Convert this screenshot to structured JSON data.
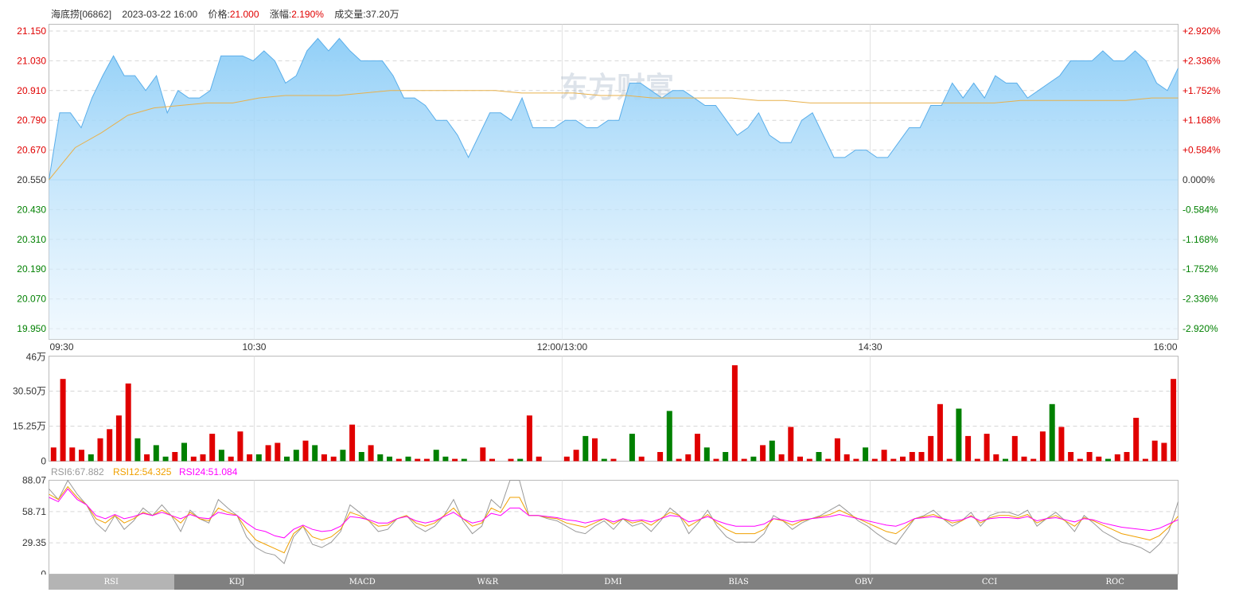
{
  "header": {
    "name_code": "海底捞[06862]",
    "datetime": "2023-03-22 16:00",
    "price_label": "价格:",
    "price_value": "21.000",
    "change_label": "涨幅:",
    "change_value": "2.190%",
    "volume_label": "成交量:",
    "volume_value": "37.20万"
  },
  "watermark": "东方财富",
  "colors": {
    "up": "#e00000",
    "down": "#008000",
    "price_line": "#5aaeea",
    "avg_line": "#e8b14c",
    "rsi6": "#999999",
    "rsi12": "#f0a000",
    "rsi24": "#ff00ff"
  },
  "tabs": [
    {
      "label": "RSI",
      "active": true
    },
    {
      "label": "KDJ",
      "active": false
    },
    {
      "label": "MACD",
      "active": false
    },
    {
      "label": "W&R",
      "active": false
    },
    {
      "label": "DMI",
      "active": false
    },
    {
      "label": "BIAS",
      "active": false
    },
    {
      "label": "OBV",
      "active": false
    },
    {
      "label": "CCI",
      "active": false
    },
    {
      "label": "ROC",
      "active": false
    }
  ],
  "rsi_legend": [
    {
      "label": "RSI6:67.882",
      "color": "#999999"
    },
    {
      "label": "RSI12:54.325",
      "color": "#f0a000"
    },
    {
      "label": "RSI24:51.084",
      "color": "#ff00ff"
    }
  ],
  "chart_data": [
    {
      "type": "area",
      "name": "intraday-price",
      "y_left_ticks": [
        "21.150",
        "21.030",
        "20.910",
        "20.790",
        "20.670",
        "20.550",
        "20.430",
        "20.310",
        "20.190",
        "20.070",
        "19.950"
      ],
      "y_right_ticks": [
        "+2.920%",
        "+2.336%",
        "+1.752%",
        "+1.168%",
        "+0.584%",
        "0.000%",
        "-0.584%",
        "-1.168%",
        "-1.752%",
        "-2.336%",
        "-2.920%"
      ],
      "x_ticks": [
        "09:30",
        "10:30",
        "12:00/13:00",
        "14:30",
        "16:00"
      ],
      "ylim": [
        19.95,
        21.15
      ],
      "base_price": 20.55,
      "price_series": [
        20.55,
        20.82,
        20.82,
        20.76,
        20.88,
        20.97,
        21.05,
        20.97,
        20.97,
        20.91,
        20.97,
        20.82,
        20.91,
        20.88,
        20.88,
        20.91,
        21.05,
        21.05,
        21.05,
        21.03,
        21.07,
        21.03,
        20.94,
        20.97,
        21.07,
        21.12,
        21.07,
        21.12,
        21.07,
        21.03,
        21.03,
        21.03,
        20.97,
        20.88,
        20.88,
        20.85,
        20.79,
        20.79,
        20.73,
        20.64,
        20.73,
        20.82,
        20.82,
        20.79,
        20.88,
        20.76,
        20.76,
        20.76,
        20.79,
        20.79,
        20.76,
        20.76,
        20.79,
        20.79,
        20.94,
        20.94,
        20.91,
        20.88,
        20.91,
        20.91,
        20.88,
        20.85,
        20.85,
        20.79,
        20.73,
        20.76,
        20.82,
        20.73,
        20.7,
        20.7,
        20.79,
        20.82,
        20.73,
        20.64,
        20.64,
        20.67,
        20.67,
        20.64,
        20.64,
        20.7,
        20.76,
        20.76,
        20.85,
        20.85,
        20.94,
        20.88,
        20.94,
        20.88,
        20.97,
        20.94,
        20.94,
        20.88,
        20.91,
        20.94,
        20.97,
        21.03,
        21.03,
        21.03,
        21.07,
        21.03,
        21.03,
        21.07,
        21.03,
        20.94,
        20.91,
        21.0
      ],
      "avg_series": [
        20.55,
        20.68,
        20.74,
        20.81,
        20.84,
        20.85,
        20.86,
        20.86,
        20.88,
        20.89,
        20.89,
        20.89,
        20.9,
        20.91,
        20.91,
        20.91,
        20.91,
        20.91,
        20.9,
        20.9,
        20.9,
        20.89,
        20.89,
        20.88,
        20.88,
        20.88,
        20.88,
        20.87,
        20.87,
        20.86,
        20.86,
        20.86,
        20.86,
        20.86,
        20.86,
        20.86,
        20.86,
        20.87,
        20.87,
        20.87,
        20.87,
        20.87,
        20.88,
        20.88
      ]
    },
    {
      "type": "bar",
      "name": "volume",
      "y_ticks": [
        "46万",
        "30.50万",
        "15.25万",
        "0"
      ],
      "ylim": [
        0,
        46
      ],
      "unit": "万",
      "values": [
        6,
        36,
        6,
        5,
        3,
        10,
        14,
        20,
        34,
        10,
        3,
        7,
        2,
        4,
        8,
        2,
        3,
        12,
        5,
        2,
        13,
        3,
        3,
        7,
        8,
        2,
        5,
        9,
        7,
        3,
        2,
        5,
        16,
        4,
        7,
        3,
        2,
        1,
        2,
        1,
        1,
        5,
        2,
        1,
        1,
        0,
        6,
        1,
        0,
        1,
        1,
        20,
        2,
        0,
        0,
        2,
        5,
        11,
        10,
        1,
        1,
        0,
        12,
        2,
        0,
        4,
        22,
        1,
        3,
        12,
        6,
        1,
        4,
        42,
        1,
        2,
        7,
        9,
        3,
        15,
        2,
        1,
        4,
        1,
        10,
        3,
        1,
        6,
        1,
        5,
        1,
        2,
        4,
        4,
        11,
        25,
        1,
        23,
        11,
        1,
        12,
        3,
        1,
        11,
        2,
        1,
        13,
        25,
        15,
        4,
        1,
        4,
        2,
        1,
        3,
        4,
        19,
        1,
        9,
        8,
        36
      ],
      "up": [
        1,
        1,
        1,
        1,
        0,
        1,
        1,
        1,
        1,
        0,
        1,
        0,
        0,
        1,
        0,
        1,
        1,
        1,
        0,
        1,
        1,
        1,
        0,
        1,
        1,
        0,
        0,
        1,
        0,
        1,
        1,
        0,
        1,
        0,
        1,
        0,
        0,
        1,
        0,
        1,
        1,
        0,
        0,
        1,
        0,
        1,
        1,
        1,
        0,
        1,
        0,
        1,
        1,
        1,
        1,
        1,
        1,
        0,
        1,
        0,
        1,
        1,
        0,
        1,
        0,
        1,
        0,
        1,
        1,
        1,
        0,
        1,
        0,
        1,
        1,
        0,
        1,
        0,
        1,
        1,
        1,
        1,
        0,
        1,
        1,
        1,
        1,
        0,
        1,
        1,
        1,
        1,
        1,
        1,
        1,
        1,
        1,
        0,
        1,
        1,
        1,
        1,
        0,
        1,
        1,
        1,
        1,
        0,
        1,
        1,
        1,
        1,
        1,
        0,
        1,
        1,
        1,
        1,
        1,
        1,
        1
      ]
    },
    {
      "type": "line",
      "name": "rsi",
      "y_ticks": [
        "88.07",
        "58.71",
        "29.35",
        "0"
      ],
      "ylim": [
        0,
        88.07
      ],
      "series": [
        {
          "name": "RSI6",
          "color": "#999999",
          "values": [
            80,
            70,
            88,
            75,
            65,
            48,
            40,
            55,
            42,
            50,
            62,
            55,
            65,
            55,
            40,
            60,
            52,
            48,
            70,
            62,
            55,
            35,
            25,
            20,
            18,
            10,
            35,
            45,
            28,
            25,
            30,
            40,
            65,
            58,
            50,
            40,
            42,
            52,
            55,
            45,
            40,
            45,
            55,
            70,
            50,
            38,
            45,
            70,
            62,
            88,
            88,
            55,
            55,
            52,
            50,
            45,
            40,
            38,
            45,
            50,
            42,
            52,
            45,
            48,
            40,
            50,
            62,
            55,
            38,
            48,
            60,
            45,
            35,
            30,
            30,
            30,
            38,
            55,
            50,
            42,
            48,
            52,
            55,
            60,
            65,
            58,
            50,
            45,
            38,
            32,
            28,
            40,
            52,
            55,
            60,
            52,
            45,
            50,
            58,
            45,
            55,
            58,
            58,
            55,
            60,
            45,
            52,
            58,
            50,
            40,
            55,
            48,
            40,
            35,
            30,
            28,
            25,
            20,
            28,
            40,
            67.882
          ]
        },
        {
          "name": "RSI12",
          "color": "#f0a000",
          "values": [
            75,
            70,
            82,
            72,
            65,
            52,
            48,
            55,
            48,
            52,
            58,
            55,
            60,
            55,
            48,
            58,
            52,
            50,
            62,
            58,
            55,
            42,
            32,
            28,
            24,
            20,
            38,
            45,
            35,
            32,
            35,
            42,
            58,
            55,
            50,
            45,
            46,
            52,
            55,
            48,
            45,
            48,
            55,
            62,
            52,
            45,
            48,
            62,
            58,
            72,
            72,
            55,
            55,
            53,
            52,
            48,
            46,
            44,
            48,
            52,
            47,
            52,
            48,
            50,
            46,
            52,
            58,
            55,
            45,
            50,
            56,
            48,
            42,
            38,
            38,
            38,
            42,
            52,
            50,
            46,
            50,
            52,
            54,
            56,
            60,
            56,
            52,
            48,
            44,
            40,
            38,
            44,
            52,
            54,
            56,
            52,
            48,
            50,
            55,
            48,
            53,
            55,
            55,
            53,
            56,
            48,
            52,
            55,
            50,
            45,
            53,
            50,
            46,
            42,
            38,
            36,
            34,
            32,
            36,
            44,
            54.325
          ]
        },
        {
          "name": "RSI24",
          "color": "#ff00ff",
          "values": [
            72,
            68,
            80,
            70,
            65,
            55,
            52,
            56,
            52,
            54,
            57,
            55,
            58,
            55,
            52,
            56,
            53,
            52,
            58,
            56,
            55,
            48,
            42,
            40,
            36,
            34,
            42,
            46,
            42,
            40,
            41,
            45,
            54,
            53,
            51,
            48,
            48,
            52,
            54,
            50,
            48,
            50,
            54,
            58,
            52,
            48,
            50,
            57,
            55,
            62,
            62,
            55,
            55,
            54,
            53,
            51,
            50,
            48,
            50,
            52,
            49,
            52,
            50,
            51,
            49,
            52,
            55,
            54,
            49,
            51,
            54,
            50,
            47,
            45,
            45,
            45,
            47,
            52,
            51,
            49,
            51,
            52,
            53,
            54,
            56,
            54,
            52,
            50,
            48,
            46,
            45,
            48,
            52,
            53,
            54,
            52,
            50,
            51,
            54,
            50,
            52,
            53,
            53,
            52,
            54,
            50,
            52,
            53,
            51,
            49,
            52,
            51,
            48,
            46,
            44,
            43,
            42,
            41,
            43,
            47,
            51.084
          ]
        }
      ]
    }
  ]
}
